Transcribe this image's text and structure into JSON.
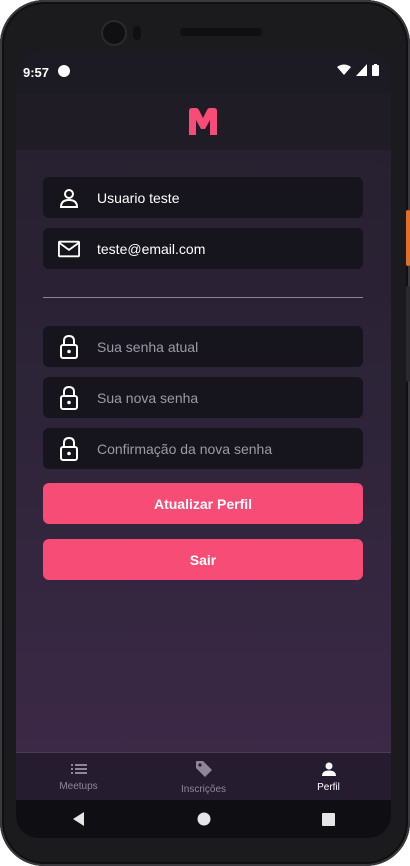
{
  "status": {
    "time": "9:57"
  },
  "app": {
    "logo_letter": "M",
    "accent": "#f64c75"
  },
  "profile": {
    "name_value": "Usuario teste",
    "email_value": "teste@email.com",
    "current_password_placeholder": "Sua senha atual",
    "new_password_placeholder": "Sua nova senha",
    "confirm_password_placeholder": "Confirmação da nova senha"
  },
  "buttons": {
    "update_label": "Atualizar Perfil",
    "logout_label": "Sair"
  },
  "tabs": [
    {
      "label": "Meetups",
      "icon": "list-icon"
    },
    {
      "label": "Inscrições",
      "icon": "tag-icon"
    },
    {
      "label": "Perfil",
      "icon": "person-icon",
      "active": true
    }
  ]
}
